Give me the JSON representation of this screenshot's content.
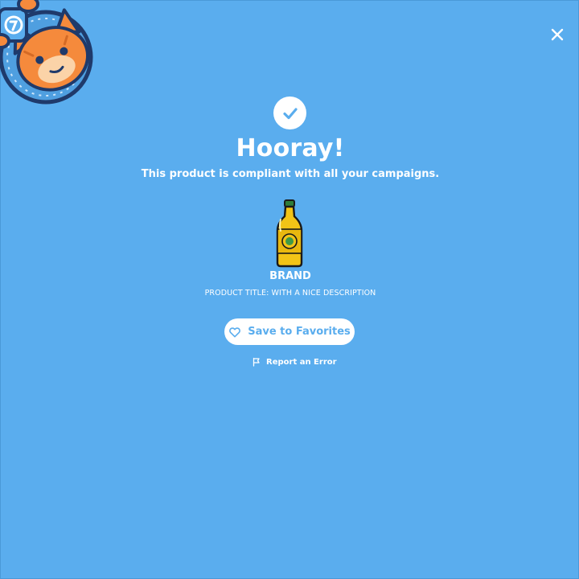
{
  "theme": {
    "background": "#5aadee",
    "accent": "#5aadee",
    "mascot_orange": "#f58a3c",
    "mascot_outline": "#1f3a6b",
    "bottle_yellow": "#f2c417",
    "bottle_cap": "#2f7d3a"
  },
  "header": {
    "mascot_icon": "cat-mascot-icon",
    "close_icon": "close-icon"
  },
  "result": {
    "status_icon": "checkmark-icon",
    "title": "Hooray!",
    "message": "This product is compliant with all your campaigns."
  },
  "product": {
    "image_icon": "bottle-icon",
    "brand": "BRAND",
    "title": "PRODUCT TITLE: WITH A NICE DESCRIPTION"
  },
  "actions": {
    "favorite_label": "Save to Favorites",
    "favorite_icon": "heart-icon",
    "report_label": "Report an Error",
    "report_icon": "flag-icon"
  }
}
